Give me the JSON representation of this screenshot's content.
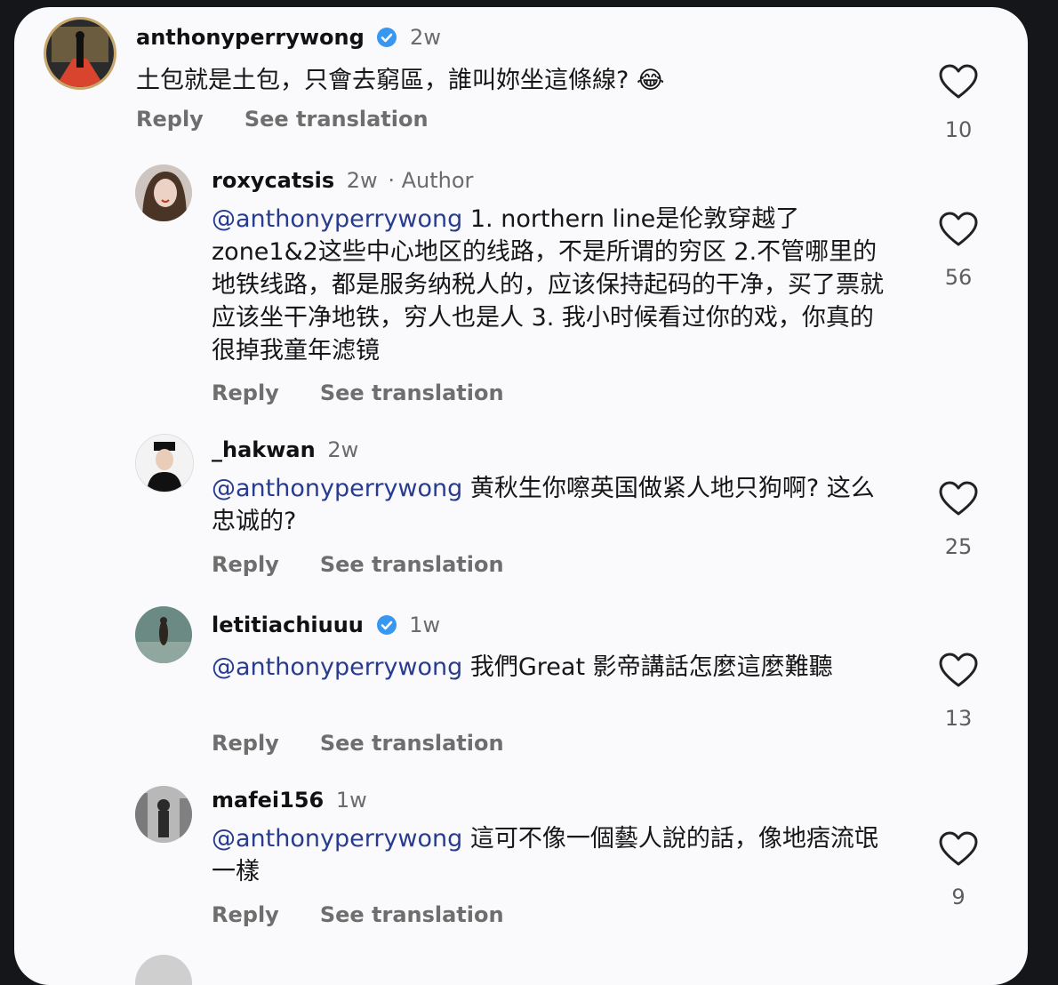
{
  "comments": [
    {
      "username": "anthonyperrywong",
      "verified": true,
      "time": "2w",
      "badge": "",
      "mention": "",
      "text": "土包就是土包，只會去窮區，誰叫妳坐這條線? 😂",
      "reply_label": "Reply",
      "translate_label": "See translation",
      "likes": "10"
    },
    {
      "username": "roxycatsis",
      "verified": false,
      "time": "2w",
      "badge": "· Author",
      "mention": "@anthonyperrywong",
      "text": " 1. northern line是伦敦穿越了zone1&2这些中心地区的线路，不是所谓的穷区 2.不管哪里的地铁线路，都是服务纳税人的，应该保持起码的干净，买了票就应该坐干净地铁，穷人也是人 3. 我小时候看过你的戏，你真的很掉我童年滤镜",
      "reply_label": "Reply",
      "translate_label": "See translation",
      "likes": "56"
    },
    {
      "username": "_hakwan",
      "verified": false,
      "time": "2w",
      "badge": "",
      "mention": "@anthonyperrywong",
      "text": " 黄秋生你嚓英国做紧人地只狗啊? 这么忠诚的?",
      "reply_label": "Reply",
      "translate_label": "See translation",
      "likes": "25"
    },
    {
      "username": "letitiachiuuu",
      "verified": true,
      "time": "1w",
      "badge": "",
      "mention": "@anthonyperrywong",
      "text": " 我們Great 影帝講話怎麼這麼難聽",
      "reply_label": "Reply",
      "translate_label": "See translation",
      "likes": "13"
    },
    {
      "username": "mafei156",
      "verified": false,
      "time": "1w",
      "badge": "",
      "mention": "@anthonyperrywong",
      "text": " 這可不像一個藝人說的話，像地痞流氓一樣",
      "reply_label": "Reply",
      "translate_label": "See translation",
      "likes": "9"
    }
  ],
  "colors": {
    "mention": "#283c8f",
    "verified": "#3897f0",
    "muted": "#6e6e6e"
  },
  "icons": {
    "like": "heart-outline-icon",
    "verified": "verified-badge-icon"
  }
}
